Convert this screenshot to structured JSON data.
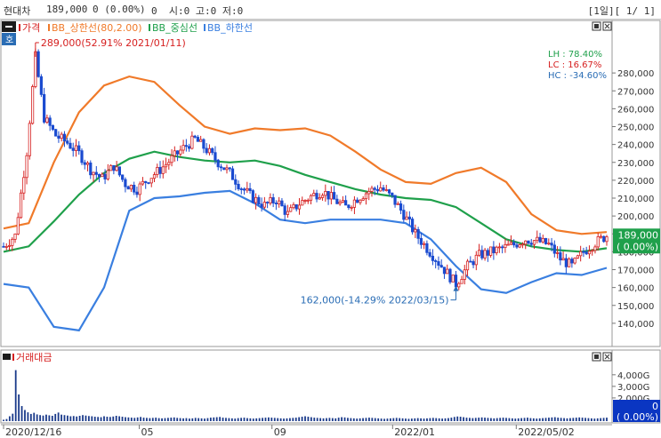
{
  "titlebar": {
    "stock_name": "현대차",
    "price": "189,000",
    "change": "0 (0.00%)",
    "ohlc": "0  시:0 고:0 저:0",
    "period": "[1일][ 1/ 1]"
  },
  "price_panel": {
    "header": {
      "label_price": "가격",
      "label_bb_upper": "BB_상한선(80,2.00)",
      "label_bb_mid": "BB_중심선",
      "label_bb_lower": "BB_하한선",
      "side_tag": "호"
    },
    "stats": {
      "lh": "LH :  78.40%",
      "lc": "LC :  16.67%",
      "hc": "HC : -34.60%"
    },
    "annotation_high": "289,000(52.91% 2021/01/11)",
    "annotation_low": "162,000(-14.29% 2022/03/15)",
    "current_price_box": "189,000",
    "current_change_box": "( 0.00%)"
  },
  "volume_panel": {
    "label": "거래대금",
    "current_value_box": "0",
    "current_change_box": "( 0.00%)"
  },
  "x_axis_labels": [
    "2020/12/16",
    "05",
    "09",
    "2022/01",
    "2022/05/02"
  ],
  "chart_data": {
    "type": "line",
    "title": "",
    "xlabel": "",
    "ylabel": "",
    "ylim": [
      130000,
      290000
    ],
    "y_ticks": [
      "280,000",
      "270,000",
      "260,000",
      "250,000",
      "240,000",
      "230,000",
      "220,000",
      "210,000",
      "200,000",
      "190,000",
      "180,000",
      "170,000",
      "160,000",
      "150,000",
      "140,000"
    ],
    "y_tick_values": [
      280000,
      270000,
      260000,
      250000,
      240000,
      230000,
      220000,
      210000,
      200000,
      190000,
      180000,
      170000,
      160000,
      150000,
      140000
    ],
    "x_ticks": [
      "2020/12/16",
      "05",
      "09",
      "2022/01",
      "2022/05/02"
    ],
    "volume_ticks": [
      "4,000G",
      "3,000G",
      "2,000G"
    ],
    "volume_tick_values": [
      4000,
      3000,
      2000
    ],
    "colors": {
      "price": "#d62020",
      "bb_upper": "#f07a2a",
      "bb_mid": "#1fa04b",
      "bb_lower": "#3a7fe0",
      "volume": "#1a3a8a",
      "current_box": "#0a36c2"
    },
    "series": [
      {
        "name": "BB_상한선(80,2.00)",
        "values": [
          193000,
          196000,
          230000,
          258000,
          273000,
          278000,
          275000,
          262000,
          250000,
          246000,
          249000,
          248000,
          249000,
          245000,
          236000,
          226000,
          219000,
          218000,
          224000,
          227000,
          219000,
          201000,
          192000,
          190000,
          191000
        ]
      },
      {
        "name": "BB_중심선",
        "values": [
          180000,
          183000,
          197000,
          212000,
          224000,
          232000,
          236000,
          233000,
          231000,
          230000,
          231000,
          228000,
          223000,
          219000,
          215000,
          212000,
          210000,
          209000,
          205000,
          196000,
          187000,
          183000,
          181000,
          180000,
          182000
        ]
      },
      {
        "name": "BB_하한선",
        "values": [
          162000,
          160000,
          138000,
          136000,
          160000,
          203000,
          210000,
          211000,
          213000,
          214000,
          207000,
          198000,
          196000,
          198000,
          198000,
          198000,
          196000,
          187000,
          172000,
          159000,
          157000,
          163000,
          168000,
          167000,
          171000
        ]
      }
    ],
    "price_path": [
      {
        "x": 0,
        "y": 183000
      },
      {
        "x": 4,
        "y": 189000
      },
      {
        "x": 8,
        "y": 236000
      },
      {
        "x": 11,
        "y": 289000
      },
      {
        "x": 14,
        "y": 255000
      },
      {
        "x": 18,
        "y": 245000
      },
      {
        "x": 22,
        "y": 241000
      },
      {
        "x": 26,
        "y": 235000
      },
      {
        "x": 30,
        "y": 226000
      },
      {
        "x": 34,
        "y": 221000
      },
      {
        "x": 38,
        "y": 228000
      },
      {
        "x": 42,
        "y": 218000
      },
      {
        "x": 46,
        "y": 215000
      },
      {
        "x": 50,
        "y": 221000
      },
      {
        "x": 54,
        "y": 226000
      },
      {
        "x": 58,
        "y": 232000
      },
      {
        "x": 62,
        "y": 238000
      },
      {
        "x": 66,
        "y": 243000
      },
      {
        "x": 70,
        "y": 237000
      },
      {
        "x": 74,
        "y": 230000
      },
      {
        "x": 78,
        "y": 224000
      },
      {
        "x": 82,
        "y": 216000
      },
      {
        "x": 86,
        "y": 210000
      },
      {
        "x": 90,
        "y": 206000
      },
      {
        "x": 94,
        "y": 209000
      },
      {
        "x": 98,
        "y": 201000
      },
      {
        "x": 102,
        "y": 207000
      },
      {
        "x": 106,
        "y": 211000
      },
      {
        "x": 110,
        "y": 214000
      },
      {
        "x": 114,
        "y": 209000
      },
      {
        "x": 118,
        "y": 205000
      },
      {
        "x": 122,
        "y": 210000
      },
      {
        "x": 126,
        "y": 214000
      },
      {
        "x": 130,
        "y": 216000
      },
      {
        "x": 134,
        "y": 210000
      },
      {
        "x": 138,
        "y": 201000
      },
      {
        "x": 142,
        "y": 190000
      },
      {
        "x": 146,
        "y": 182000
      },
      {
        "x": 150,
        "y": 174000
      },
      {
        "x": 154,
        "y": 166000
      },
      {
        "x": 156,
        "y": 162000
      },
      {
        "x": 160,
        "y": 172000
      },
      {
        "x": 164,
        "y": 178000
      },
      {
        "x": 168,
        "y": 180000
      },
      {
        "x": 172,
        "y": 182000
      },
      {
        "x": 176,
        "y": 184000
      },
      {
        "x": 180,
        "y": 187000
      },
      {
        "x": 184,
        "y": 186000
      },
      {
        "x": 188,
        "y": 184000
      },
      {
        "x": 192,
        "y": 176000
      },
      {
        "x": 196,
        "y": 172000
      },
      {
        "x": 200,
        "y": 180000
      },
      {
        "x": 204,
        "y": 185000
      },
      {
        "x": 208,
        "y": 189000
      }
    ],
    "price_x_max": 208,
    "high_point": {
      "x": 11,
      "y": 289000
    },
    "low_point": {
      "x": 156,
      "y": 162000
    },
    "current_price": 189000,
    "volume": [
      120,
      180,
      420,
      640,
      4400,
      2300,
      1300,
      960,
      760,
      620,
      720,
      580,
      520,
      480,
      560,
      500,
      460,
      620,
      740,
      560,
      520,
      480,
      420,
      440,
      400,
      460,
      520,
      480,
      440,
      420,
      380,
      360,
      340,
      420,
      380,
      360,
      400,
      460,
      420,
      380,
      340,
      320,
      300,
      280,
      320,
      360,
      300,
      280,
      260,
      280,
      300,
      260,
      240,
      260,
      280,
      300,
      320,
      280,
      260,
      240,
      260,
      220,
      240,
      280,
      260,
      240,
      220,
      260,
      300,
      320,
      340,
      360,
      300,
      280,
      260,
      240,
      220,
      260,
      280,
      300,
      260,
      240,
      220,
      240,
      260,
      280,
      300,
      320,
      300,
      280,
      260,
      240,
      220,
      240,
      260,
      280,
      300,
      340,
      380,
      420,
      380,
      340,
      300,
      280,
      260,
      240,
      260,
      280,
      260,
      240,
      300,
      340,
      320,
      280,
      260,
      240,
      220,
      240,
      260,
      280,
      300,
      280,
      260,
      240,
      220,
      200,
      220,
      240,
      260,
      280,
      260,
      240,
      220,
      200,
      220,
      240,
      260,
      240,
      220,
      240,
      260,
      280,
      260,
      240,
      220,
      240,
      260,
      300,
      360,
      400,
      380,
      340,
      300,
      280,
      260,
      280,
      300,
      320,
      300,
      280,
      260,
      240,
      260,
      280,
      300,
      280,
      260,
      240,
      220,
      240,
      260,
      280,
      300,
      260,
      240,
      220,
      240,
      260,
      280,
      300,
      320,
      340,
      300,
      280,
      260,
      240,
      260,
      280,
      300,
      320,
      300,
      280,
      260,
      240,
      220,
      240,
      260,
      280,
      300
    ]
  }
}
